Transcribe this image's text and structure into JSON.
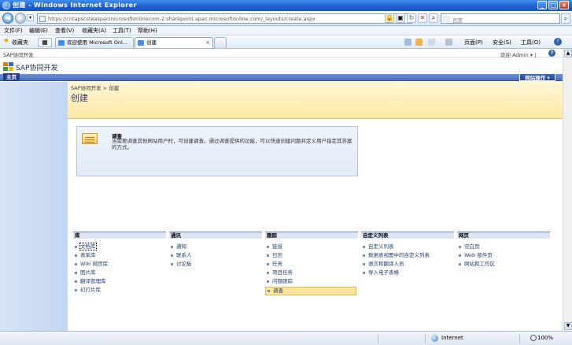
{
  "window": {
    "title": "创建 - Windows Internet Explorer",
    "min_label": "_",
    "max_label": "□",
    "close_label": "×"
  },
  "address_bar": {
    "url": "https://cntapscsteaspacmicrosoftonlinecom-2.sharepoint.apac.microsoftonline.com/_layouts/create.aspx",
    "search_placeholder": "百度",
    "back_glyph": "◀",
    "forward_glyph": "▶"
  },
  "menubar": {
    "items": [
      "文件(F)",
      "编辑(E)",
      "查看(V)",
      "收藏夹(A)",
      "工具(T)",
      "帮助(H)"
    ]
  },
  "favorites_bar": {
    "favorites_label": "收藏夹",
    "tabs": [
      {
        "label": "欢迎使用 Microsoft Onl...",
        "active": false
      },
      {
        "label": "创建",
        "active": true
      }
    ],
    "commands": [
      "页面(P)",
      "安全(S)",
      "工具(O)"
    ],
    "help_glyph": "?"
  },
  "sharepoint": {
    "site_small_name": "SAP协同开发",
    "welcome_user": "欢迎 Admin ▾ |",
    "help_glyph": "?",
    "site_title": "SAP协同开发",
    "home_tab": "主页",
    "site_actions": "网站操作 ▾",
    "breadcrumb": "SAP协同开发  >  创建",
    "page_title": "创建",
    "description": {
      "heading": "调查",
      "body": "当需要调查其他网站用户时，可创建调查。通过调查提供的功能，可以快速创建问题并定义用户指定其答案的方式。"
    },
    "categories": [
      {
        "title": "库",
        "items": [
          "文档库",
          "表单库",
          "Wiki 网页库",
          "图片库",
          "翻译管理库",
          "幻灯片库"
        ]
      },
      {
        "title": "通讯",
        "items": [
          "通知",
          "联系人",
          "讨论板"
        ]
      },
      {
        "title": "跟踪",
        "items": [
          "链接",
          "日历",
          "任务",
          "项目任务",
          "问题跟踪",
          "调查"
        ]
      },
      {
        "title": "自定义列表",
        "items": [
          "自定义列表",
          "数据表视图中的自定义列表",
          "语言和翻译人员",
          "导入电子表格"
        ]
      },
      {
        "title": "网页",
        "items": [
          "空白页",
          "Web 部件页",
          "网站和工作区"
        ]
      }
    ],
    "selected_item": "调查",
    "focused_item": "文档库"
  },
  "statusbar": {
    "zone": "Internet",
    "zoom": "100%"
  },
  "colors": {
    "titlebar": "#1e5ed0",
    "sp_topnav": "#4a70c2",
    "page_header": "#ffe9a6",
    "leftnav": "#c3d6f1",
    "selected": "#ffe59b"
  }
}
